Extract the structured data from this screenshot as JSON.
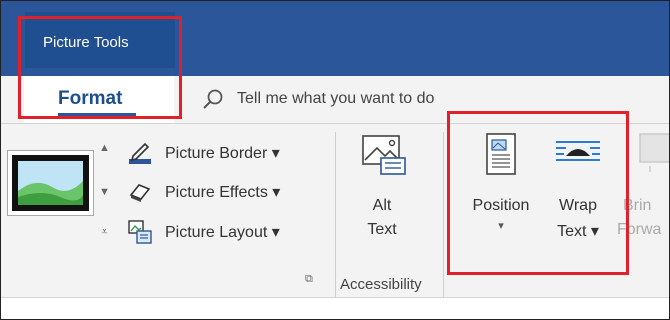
{
  "contextual_group": {
    "label": "Picture Tools"
  },
  "tabs": {
    "active": "Format"
  },
  "tell_me": {
    "text": "Tell me what you want to do"
  },
  "picture_styles": {
    "commands": [
      {
        "icon": "picture-border-icon",
        "label": "Picture Border ▾"
      },
      {
        "icon": "picture-effects-icon",
        "label": "Picture Effects ▾"
      },
      {
        "icon": "picture-layout-icon",
        "label": "Picture Layout ▾"
      }
    ],
    "launcher": "⧉"
  },
  "accessibility": {
    "alt_text": {
      "line1": "Alt",
      "line2": "Text"
    },
    "group_label": "Accessibility"
  },
  "arrange": {
    "position": {
      "line1": "Position",
      "line2": "▾"
    },
    "wrap_text": {
      "line1": "Wrap",
      "line2": "Text ▾"
    },
    "bring_forward": {
      "line1": "Brin",
      "line2": "Forwa"
    }
  },
  "colors": {
    "accent": "#2b579a",
    "highlight": "#e0202a"
  }
}
